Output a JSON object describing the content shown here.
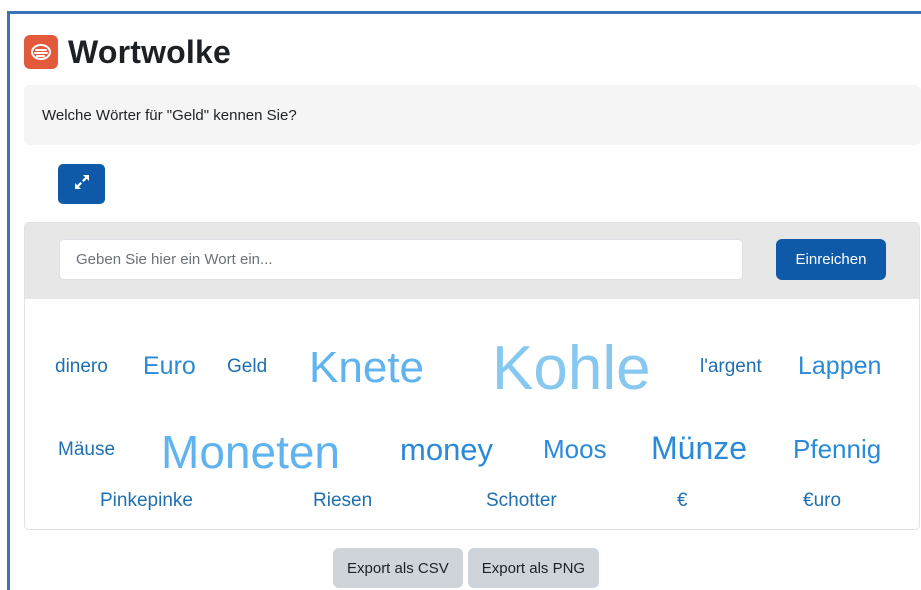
{
  "app": {
    "title": "Wortwolke",
    "logo_icon": "wordcloud-logo-icon",
    "accent": "#e2593b"
  },
  "question": {
    "text": "Welche Wörter für \"Geld\" kennen Sie?"
  },
  "toolbar": {
    "expand_icon": "expand-arrows-icon"
  },
  "input": {
    "placeholder": "Geben Sie hier ein Wort ein...",
    "value": ""
  },
  "submit": {
    "label": "Einreichen"
  },
  "cloud": {
    "words": [
      "dinero",
      "Euro",
      "Geld",
      "Knete",
      "Kohle",
      "l'argent",
      "Lappen",
      "Mäuse",
      "Moneten",
      "money",
      "Moos",
      "Münze",
      "Pfennig",
      "Pinkepinke",
      "Riesen",
      "Schotter",
      "€",
      "€uro"
    ]
  },
  "export": {
    "csv_label": "Export als CSV",
    "png_label": "Export als PNG"
  },
  "colors": {
    "primary": "#0f5aa8",
    "frame": "#3a73b8",
    "word_dark": "#1f6fb0",
    "word_light": "#86c8f0"
  }
}
